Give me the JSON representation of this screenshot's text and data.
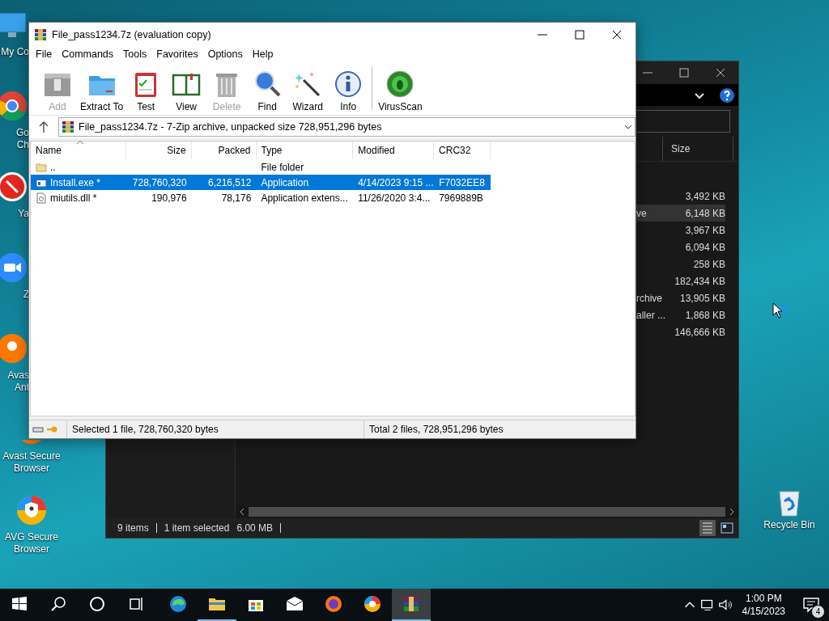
{
  "desktop_icons": [
    {
      "kind": "computer",
      "cut": true,
      "lines": [
        "My Co"
      ]
    },
    {
      "kind": "chrome",
      "cut": true,
      "lines": [
        "Go",
        "Ch"
      ]
    },
    {
      "kind": "yandex",
      "cut": true,
      "lines": [
        "Ya"
      ]
    },
    {
      "kind": "zoom",
      "cut": true,
      "lines": [
        "Z"
      ]
    },
    {
      "kind": "avast",
      "cut": true,
      "lines": [
        "Avas",
        "Ant"
      ]
    },
    {
      "kind": "avast-browser",
      "cut": false,
      "lines": [
        "Avast Secure",
        "Browser"
      ]
    },
    {
      "kind": "avg",
      "cut": false,
      "lines": [
        "AVG Secure",
        "Browser"
      ]
    }
  ],
  "recycle_bin": {
    "label": "Recycle Bin"
  },
  "explorer": {
    "columns": [
      "Size"
    ],
    "rows": [
      {
        "name": "",
        "size": "3,492 KB",
        "selected": false
      },
      {
        "name": "ve",
        "size": "6,148 KB",
        "selected": true
      },
      {
        "name": "",
        "size": "3,967 KB",
        "selected": false
      },
      {
        "name": "",
        "size": "6,094 KB",
        "selected": false
      },
      {
        "name": "",
        "size": "258 KB",
        "selected": false
      },
      {
        "name": "",
        "size": "182,434 KB",
        "selected": false
      },
      {
        "name": "rchive",
        "size": "13,905 KB",
        "selected": false
      },
      {
        "name": "aller ...",
        "size": "1,868 KB",
        "selected": false
      },
      {
        "name": "",
        "size": "146,666 KB",
        "selected": false
      }
    ],
    "status": [
      "9 items",
      "1 item selected",
      "6.00 MB"
    ]
  },
  "winrar": {
    "title": "File_pass1234.7z (evaluation copy)",
    "menu": [
      "File",
      "Commands",
      "Tools",
      "Favorites",
      "Options",
      "Help"
    ],
    "toolbar": [
      {
        "kind": "add",
        "label": "Add",
        "disabled": true
      },
      {
        "kind": "extract",
        "label": "Extract To",
        "disabled": false
      },
      {
        "kind": "test",
        "label": "Test",
        "disabled": false
      },
      {
        "kind": "view",
        "label": "View",
        "disabled": false
      },
      {
        "kind": "delete",
        "label": "Delete",
        "disabled": true
      },
      {
        "kind": "find",
        "label": "Find",
        "disabled": false
      },
      {
        "kind": "wizard",
        "label": "Wizard",
        "disabled": false
      },
      {
        "kind": "info",
        "label": "Info",
        "disabled": false
      },
      {
        "kind": "virusscan",
        "label": "VirusScan",
        "disabled": false
      }
    ],
    "address": "File_pass1234.7z - 7-Zip archive, unpacked size 728,951,296 bytes",
    "columns": [
      "Name",
      "Size",
      "Packed",
      "Type",
      "Modified",
      "CRC32"
    ],
    "rows": [
      {
        "kind": "folder",
        "name": "..",
        "size": "",
        "packed": "",
        "type": "File folder",
        "modified": "",
        "crc": "",
        "selected": false
      },
      {
        "kind": "exe",
        "name": "Install.exe *",
        "size": "728,760,320",
        "packed": "6,216,512",
        "type": "Application",
        "modified": "4/14/2023 9:15 ...",
        "crc": "F7032EE8",
        "selected": true
      },
      {
        "kind": "dll",
        "name": "miutils.dll *",
        "size": "190,976",
        "packed": "78,176",
        "type": "Application extens...",
        "modified": "11/26/2020 3:4...",
        "crc": "7969889B",
        "selected": false
      }
    ],
    "status_left": "Selected 1 file, 728,760,320 bytes",
    "status_right": "Total 2 files, 728,951,296 bytes"
  },
  "taskbar": {
    "items": [
      {
        "kind": "start",
        "running": false,
        "selected": false
      },
      {
        "kind": "search",
        "running": false,
        "selected": false
      },
      {
        "kind": "cortana",
        "running": false,
        "selected": false
      },
      {
        "kind": "taskview",
        "running": false,
        "selected": false
      },
      {
        "kind": "edge",
        "running": false,
        "selected": false
      },
      {
        "kind": "explorer",
        "running": true,
        "selected": false
      },
      {
        "kind": "store",
        "running": false,
        "selected": false
      },
      {
        "kind": "mail",
        "running": false,
        "selected": false
      },
      {
        "kind": "avast-browser",
        "running": false,
        "selected": false
      },
      {
        "kind": "avg",
        "running": false,
        "selected": false
      },
      {
        "kind": "winrar",
        "running": true,
        "selected": true
      }
    ],
    "time": "1:00 PM",
    "date": "4/15/2023",
    "notifications": "4"
  }
}
